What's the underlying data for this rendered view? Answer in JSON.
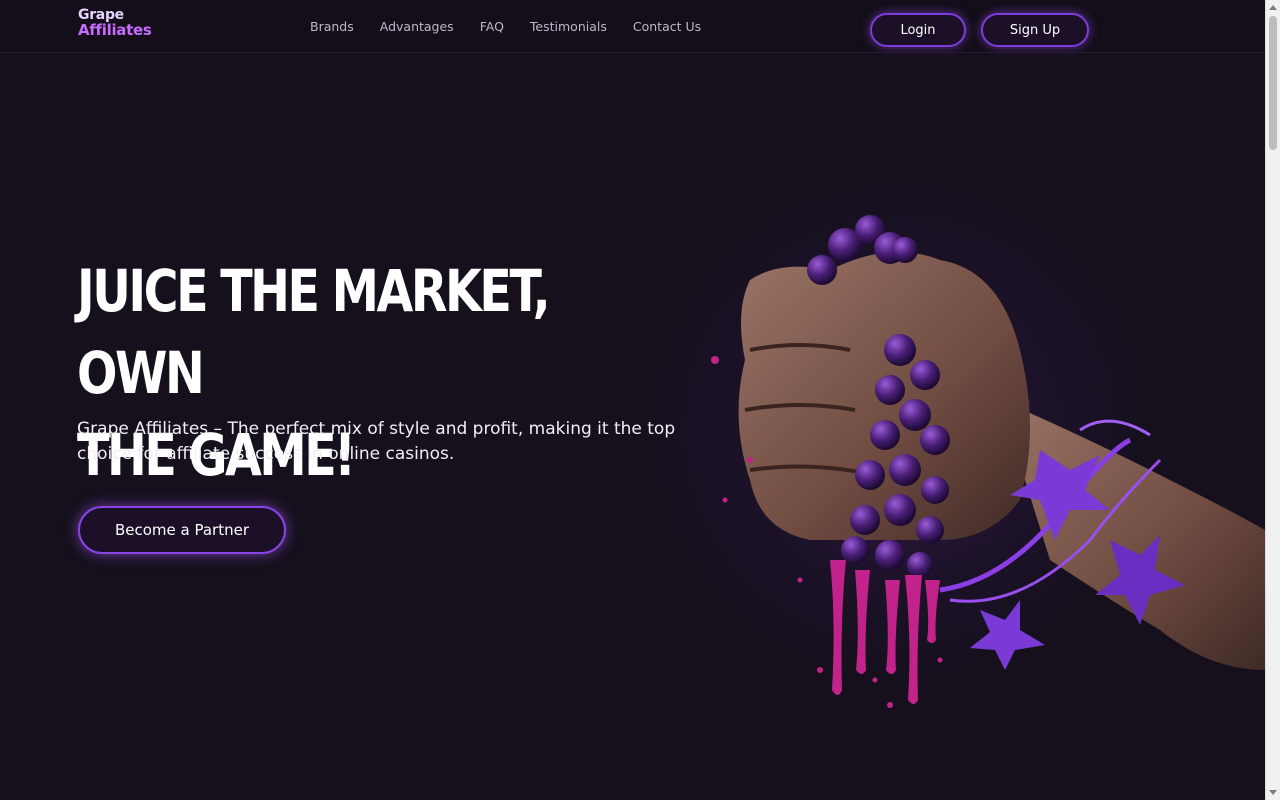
{
  "logo": {
    "line1": "Grape",
    "line2": "Affiliates"
  },
  "nav": [
    {
      "label": "Brands"
    },
    {
      "label": "Advantages"
    },
    {
      "label": "FAQ"
    },
    {
      "label": "Testimonials"
    },
    {
      "label": "Contact Us"
    }
  ],
  "header_buttons": {
    "login": "Login",
    "signup": "Sign Up"
  },
  "hero": {
    "headline_line1": "Juice the market, own",
    "headline_line2": "the game!",
    "subtext": "Grape Affiliates – The perfect mix of style and profit, making it the top choice for affiliate success in online casinos.",
    "cta": "Become a Partner"
  },
  "hero_image": {
    "icon": "fist-squeezing-grapes-image"
  },
  "colors": {
    "background": "#15101c",
    "accent": "#8a44e6",
    "logo_purple": "#c86bff"
  }
}
